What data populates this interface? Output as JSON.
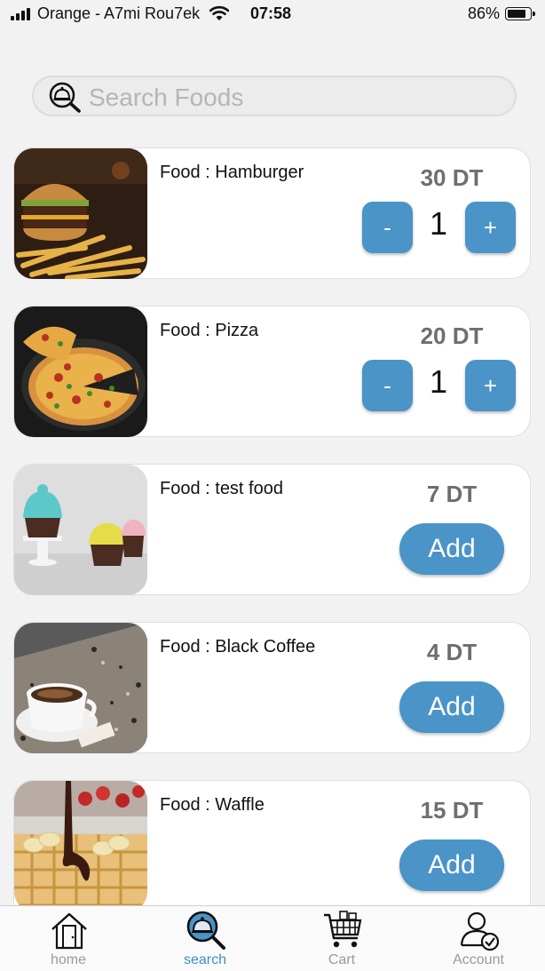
{
  "status_bar": {
    "carrier": "Orange - A7mi Rou7ek",
    "time": "07:58",
    "battery": "86%"
  },
  "search": {
    "placeholder": "Search Foods",
    "value": ""
  },
  "foods": [
    {
      "name": "Food : Hamburger",
      "price": "30 DT",
      "in_cart": true,
      "qty": "1",
      "minus": "-",
      "plus": "+"
    },
    {
      "name": "Food : Pizza",
      "price": "20 DT",
      "in_cart": true,
      "qty": "1",
      "minus": "-",
      "plus": "+"
    },
    {
      "name": "Food : test food",
      "price": "7 DT",
      "in_cart": false,
      "add": "Add"
    },
    {
      "name": "Food : Black Coffee",
      "price": "4 DT",
      "in_cart": false,
      "add": "Add"
    },
    {
      "name": "Food : Waffle",
      "price": "15 DT",
      "in_cart": false,
      "add": "Add"
    }
  ],
  "tabs": [
    {
      "label": "home",
      "icon": "house-icon",
      "active": false
    },
    {
      "label": "search",
      "icon": "search-cloche-icon",
      "active": true
    },
    {
      "label": "Cart",
      "icon": "cart-icon",
      "active": false
    },
    {
      "label": "Account",
      "icon": "account-icon",
      "active": false
    }
  ],
  "colors": {
    "accent": "#4a94c7",
    "active_tab": "#3c8fc8",
    "price": "#6e6e6e",
    "background": "#f2f2f2"
  }
}
